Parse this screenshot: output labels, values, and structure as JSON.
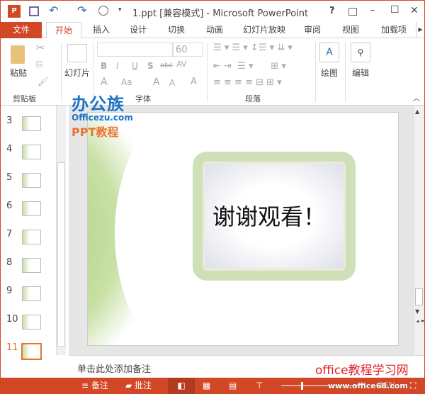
{
  "titlebar": {
    "title": "1.ppt [兼容模式] - Microsoft PowerPoint",
    "help": "?",
    "minimize": "–",
    "maximize": "☐",
    "close": "✕"
  },
  "tabs": [
    {
      "label": "文件"
    },
    {
      "label": "开始"
    },
    {
      "label": "插入"
    },
    {
      "label": "设计"
    },
    {
      "label": "切换"
    },
    {
      "label": "动画"
    },
    {
      "label": "幻灯片放映"
    },
    {
      "label": "审阅"
    },
    {
      "label": "视图"
    },
    {
      "label": "加载项"
    }
  ],
  "ribbon": {
    "clipboard": {
      "paste": "粘贴",
      "label": "剪贴板"
    },
    "slides": {
      "new_slide": "幻灯片"
    },
    "font": {
      "font_name": "",
      "font_size": "60",
      "bold": "B",
      "italic": "I",
      "underline": "U",
      "shadow": "S",
      "strike": "abc",
      "spacing": "AV",
      "color": "A",
      "case": "Aa",
      "label": "字体"
    },
    "paragraph": {
      "label": "段落"
    },
    "drawing": {
      "label": "绘图"
    },
    "editing": {
      "label": "编辑"
    }
  },
  "thumbnails": [
    {
      "number": "3"
    },
    {
      "number": "4"
    },
    {
      "number": "5"
    },
    {
      "number": "6"
    },
    {
      "number": "7"
    },
    {
      "number": "8"
    },
    {
      "number": "9"
    },
    {
      "number": "10"
    },
    {
      "number": "11",
      "selected": true
    }
  ],
  "slide": {
    "text": "谢谢观看！"
  },
  "watermarks": {
    "logo_main": "办公族",
    "logo_sub": "Officezu.com",
    "logo_ppt": "PPT教程",
    "site": "office教程学习网",
    "url": "www.office68.com"
  },
  "notes": {
    "placeholder": "单击此处添加备注"
  },
  "status": {
    "notes": "备注",
    "comments": "批注",
    "zoom": "46%"
  },
  "colors": {
    "accent": "#d24726",
    "selected_thumb": "#e8742f"
  }
}
